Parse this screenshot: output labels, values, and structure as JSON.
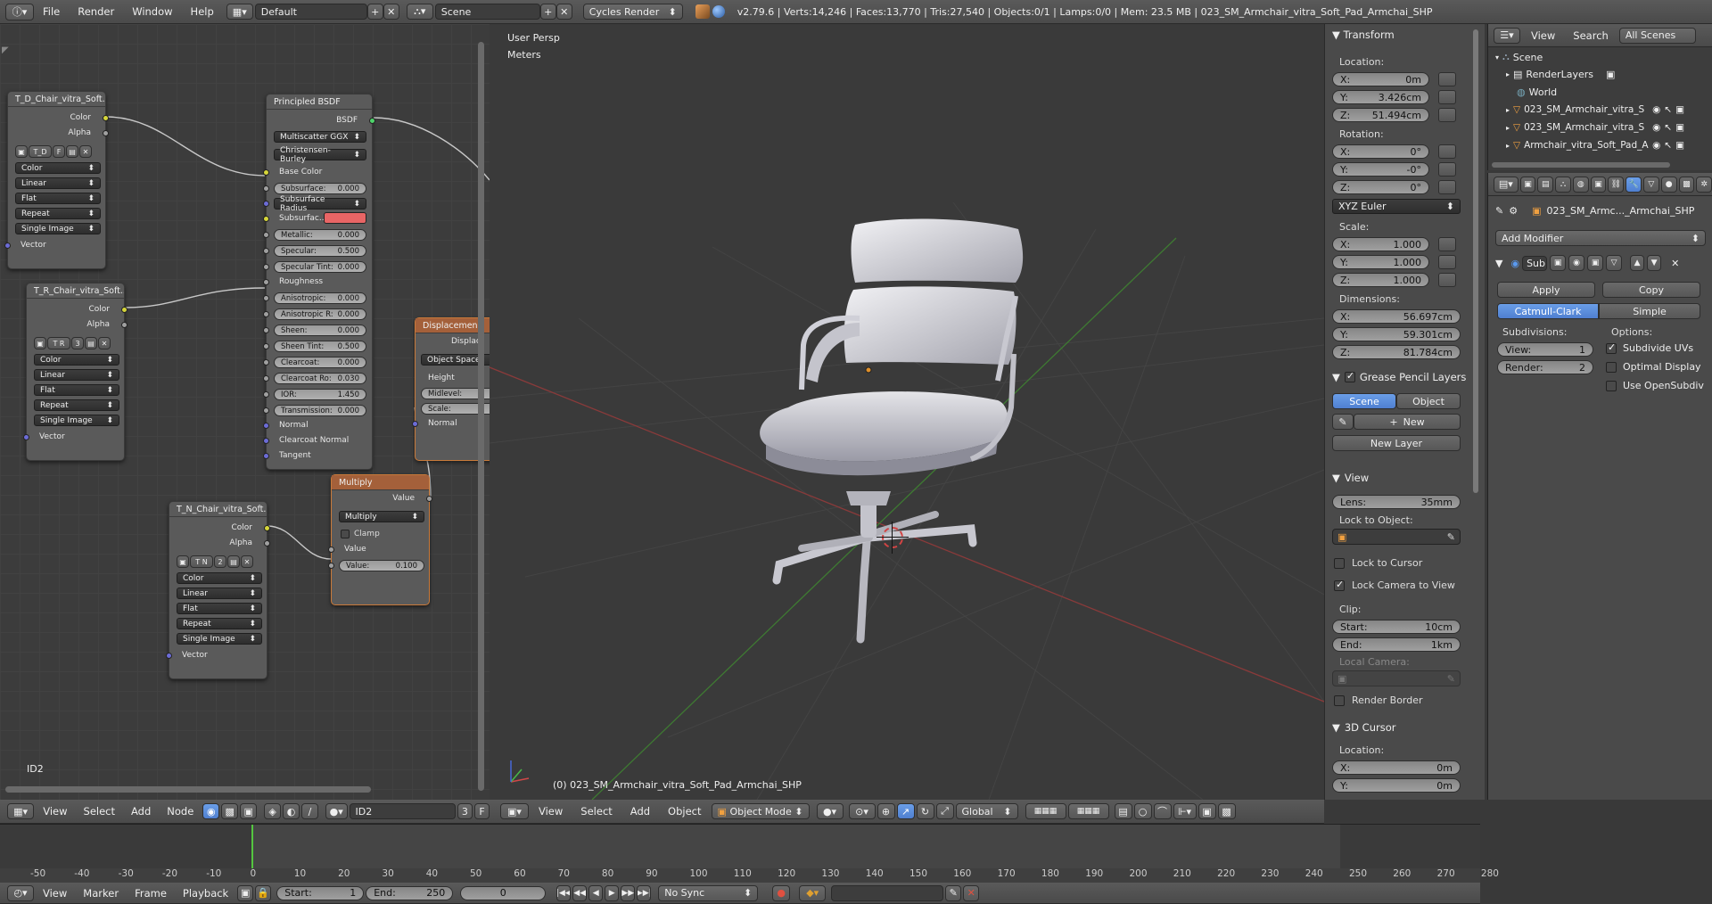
{
  "topbar": {
    "menus": [
      "File",
      "Render",
      "Window",
      "Help"
    ],
    "layout": "Default",
    "scene": "Scene",
    "engine": "Cycles Render",
    "stats": "v2.79.6 | Verts:14,246 | Faces:13,770 | Tris:27,540 | Objects:0/1 | Lamps:0/0 | Mem: 23.5 MB | 023_SM_Armchair_vitra_Soft_Pad_Armchai_SHP"
  },
  "node_editor": {
    "label": "ID2",
    "header_menus": [
      "View",
      "Select",
      "Add",
      "Node"
    ],
    "material": "ID2",
    "users": "3",
    "fake": "F",
    "tex_nodes": [
      {
        "title": "T_D_Chair_vitra_Soft...",
        "code": "T_D",
        "num": "F",
        "color": "Color",
        "alpha": "Alpha",
        "space": "Color",
        "interp": "Linear",
        "proj": "Flat",
        "ext": "Repeat",
        "src": "Single Image",
        "vector": "Vector"
      },
      {
        "title": "T_R_Chair_vitra_Soft...",
        "code": "T R",
        "num": "3",
        "color": "Color",
        "alpha": "Alpha",
        "space": "Color",
        "interp": "Linear",
        "proj": "Flat",
        "ext": "Repeat",
        "src": "Single Image",
        "vector": "Vector"
      },
      {
        "title": "T_N_Chair_vitra_Soft...",
        "code": "T N",
        "num": "2",
        "color": "Color",
        "alpha": "Alpha",
        "space": "Color",
        "interp": "Linear",
        "proj": "Flat",
        "ext": "Repeat",
        "src": "Single Image",
        "vector": "Vector"
      }
    ],
    "bsdf": {
      "title": "Principled BSDF",
      "out": "BSDF",
      "dist": "Multiscatter GGX",
      "sss": "Christensen-Burley",
      "base": "Base Color",
      "subsurface": "Subsurface:",
      "subsurface_v": "0.000",
      "radius": "Subsurface Radius",
      "subcolor": "Subsurfac...",
      "metallic": "Metallic:",
      "metallic_v": "0.000",
      "specular": "Specular:",
      "specular_v": "0.500",
      "spectint": "Specular Tint:",
      "spectint_v": "0.000",
      "roughness": "Roughness",
      "aniso": "Anisotropic:",
      "aniso_v": "0.000",
      "anisor": "Anisotropic R:",
      "anisor_v": "0.000",
      "sheen": "Sheen:",
      "sheen_v": "0.000",
      "sheentint": "Sheen Tint:",
      "sheentint_v": "0.500",
      "clearcoat": "Clearcoat:",
      "clearcoat_v": "0.000",
      "ccr": "Clearcoat Ro:",
      "ccr_v": "0.030",
      "ior": "IOR:",
      "ior_v": "1.450",
      "trans": "Transmission:",
      "trans_v": "0.000",
      "normal": "Normal",
      "ccnormal": "Clearcoat Normal",
      "tangent": "Tangent"
    },
    "disp": {
      "title": "Displacemen",
      "out": "Displac",
      "space": "Object Space",
      "height": "Height",
      "mid": "Midlevel:",
      "scale": "Scale:",
      "normal": "Normal"
    },
    "mult": {
      "title": "Multiply",
      "out": "Value",
      "op": "Multiply",
      "clamp": "Clamp",
      "in": "Value",
      "val": "Value:",
      "val_v": "0.100"
    }
  },
  "viewport": {
    "persp": "User Persp",
    "units": "Meters",
    "object": "(0) 023_SM_Armchair_vitra_Soft_Pad_Armchai_SHP",
    "header_menus": [
      "View",
      "Select",
      "Add",
      "Object"
    ],
    "mode": "Object Mode",
    "orientation": "Global"
  },
  "npanel": {
    "transform": "Transform",
    "location": "Location:",
    "loc": [
      {
        "a": "X:",
        "v": "0m"
      },
      {
        "a": "Y:",
        "v": "3.426cm"
      },
      {
        "a": "Z:",
        "v": "51.494cm"
      }
    ],
    "rotation": "Rotation:",
    "rot": [
      {
        "a": "X:",
        "v": "0°"
      },
      {
        "a": "Y:",
        "v": "-0°"
      },
      {
        "a": "Z:",
        "v": "0°"
      }
    ],
    "rotmode": "XYZ Euler",
    "scale": "Scale:",
    "scl": [
      {
        "a": "X:",
        "v": "1.000"
      },
      {
        "a": "Y:",
        "v": "1.000"
      },
      {
        "a": "Z:",
        "v": "1.000"
      }
    ],
    "dimensions": "Dimensions:",
    "dim": [
      {
        "a": "X:",
        "v": "56.697cm"
      },
      {
        "a": "Y:",
        "v": "59.301cm"
      },
      {
        "a": "Z:",
        "v": "81.784cm"
      }
    ],
    "gp": "Grease Pencil Layers",
    "gp_scene": "Scene",
    "gp_object": "Object",
    "gp_new": "New",
    "gp_newlayer": "New Layer",
    "view": "View",
    "lens_l": "Lens:",
    "lens_v": "35mm",
    "lockobj": "Lock to Object:",
    "lockcursor": "Lock to Cursor",
    "lockcam": "Lock Camera to View",
    "clip": "Clip:",
    "start_l": "Start:",
    "start_v": "10cm",
    "end_l": "End:",
    "end_v": "1km",
    "localcam": "Local Camera:",
    "renderborder": "Render Border",
    "cursor": "3D Cursor",
    "cloc": "Location:",
    "cx_l": "X:",
    "cx_v": "0m",
    "cy_l": "Y:",
    "cy_v": "0m"
  },
  "outliner": {
    "menus": [
      "View",
      "Search"
    ],
    "filter": "All Scenes",
    "items": [
      "Scene",
      "RenderLayers",
      "World",
      "023_SM_Armchair_vitra_S",
      "023_SM_Armchair_vitra_S",
      "Armchair_vitra_Soft_Pad_A"
    ]
  },
  "props": {
    "object": "023_SM_Armc..._Armchai_SHP",
    "add_modifier": "Add Modifier",
    "mod_name": "Sub",
    "apply": "Apply",
    "copy": "Copy",
    "catmull": "Catmull-Clark",
    "simple": "Simple",
    "subdivisions": "Subdivisions:",
    "view_l": "View:",
    "view_v": "1",
    "render_l": "Render:",
    "render_v": "2",
    "options": "Options:",
    "subuv": "Subdivide UVs",
    "optdisp": "Optimal Display",
    "opensubdiv": "Use OpenSubdiv"
  },
  "timeline": {
    "ticks": [
      "-50",
      "-40",
      "-30",
      "-20",
      "-10",
      "0",
      "10",
      "20",
      "30",
      "40",
      "50",
      "60",
      "70",
      "80",
      "90",
      "100",
      "110",
      "120",
      "130",
      "140",
      "150",
      "160",
      "170",
      "180",
      "190",
      "200",
      "210",
      "220",
      "230",
      "240",
      "250",
      "260",
      "270",
      "280"
    ],
    "menus": [
      "View",
      "Marker",
      "Frame",
      "Playback"
    ],
    "start_l": "Start:",
    "start_v": "1",
    "end_l": "End:",
    "end_v": "250",
    "current": "0",
    "sync": "No Sync"
  }
}
